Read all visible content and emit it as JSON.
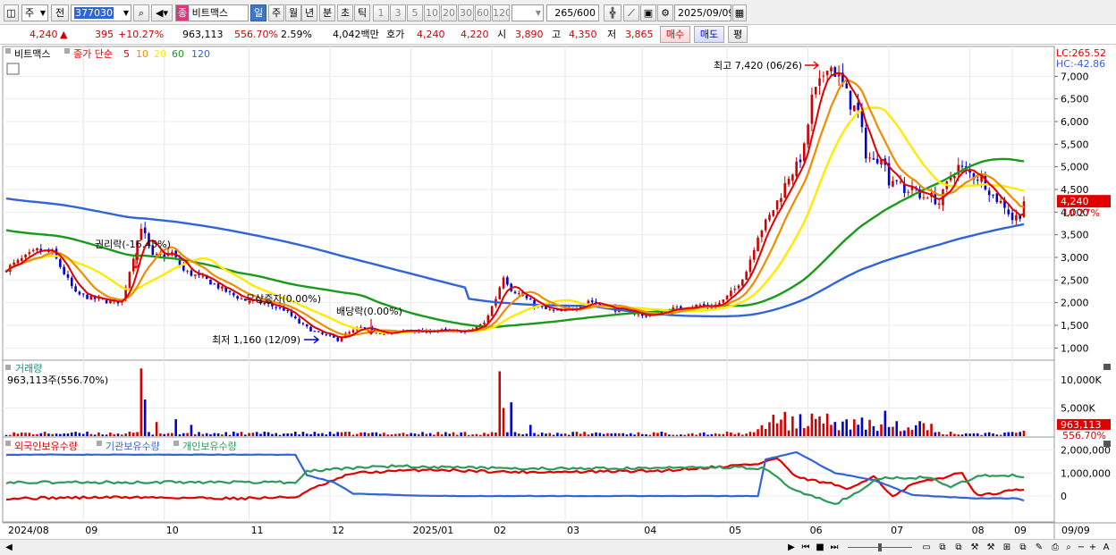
{
  "toolbar": {
    "market": "주",
    "prev": "전",
    "code": "377030",
    "name_badge": "종",
    "name": "비트맥스",
    "periods": [
      "일",
      "주",
      "월",
      "년",
      "분",
      "초",
      "틱"
    ],
    "active_period": "일",
    "intervals": [
      "1",
      "3",
      "5",
      "10",
      "20",
      "30",
      "60",
      "120"
    ],
    "count": "265",
    "count_max": "/600",
    "date": "2025/09/09"
  },
  "quote": {
    "price": "4,240",
    "arrow": "▲",
    "change": "395",
    "change_pct": "+10.27%",
    "volume": "963,113",
    "vol_ratio": "556.70%",
    "turnover": "2.59%",
    "amount": "4,042백만",
    "bid_label": "호가",
    "ask": "4,240",
    "bid": "4,220",
    "open_label": "시",
    "open": "3,890",
    "high_label": "고",
    "high": "4,350",
    "low_label": "저",
    "low": "3,865",
    "buy": "매수",
    "sell": "매도",
    "fav": "평"
  },
  "colors": {
    "up": "#d10000",
    "down": "#0000d0",
    "ma5": "#e00000",
    "ma10": "#f08c00",
    "ma20": "#ffeb00",
    "ma60": "#1a9a1a",
    "ma120": "#3064d8",
    "foreign": "#e00000",
    "inst": "#3064d8",
    "indiv": "#2e9a5a",
    "badge": "#e00000"
  },
  "price_panel": {
    "stock_label": "비트맥스",
    "ma_title": "종가 단순",
    "ma_labels": [
      "5",
      "10",
      "20",
      "60",
      "120"
    ],
    "lc": "LC:265.52",
    "hc": "HC:-42.86",
    "price_tag": "4,240",
    "pct_tag": "10.27%",
    "annotations": {
      "high": "최고 7,420 (06/26)",
      "low": "최저 1,160 (12/09)",
      "rights": "권리락(-16.45%)",
      "bonus": "무상증자(0.00%)",
      "dividend": "배당락(0.00%)"
    }
  },
  "volume_panel": {
    "title": "거래량",
    "value": "963,113주(556.70%)",
    "tag1": "963,113",
    "tag2": "556.70%"
  },
  "holdings_panel": {
    "labels": [
      "외국인보유수량",
      "기관보유수량",
      "개인보유수량"
    ]
  },
  "chart_data": {
    "type": "candlestick",
    "title": "비트맥스",
    "x_labels": [
      "2024/08",
      "09",
      "10",
      "11",
      "12",
      "2025/01",
      "02",
      "03",
      "04",
      "05",
      "06",
      "07",
      "08",
      "09",
      "09/09"
    ],
    "price_ticks": [
      "7,000",
      "6,500",
      "6,000",
      "5,500",
      "5,000",
      "4,500",
      "4,000",
      "3,500",
      "3,000",
      "2,500",
      "2,000",
      "1,500",
      "1,000"
    ],
    "price_range": [
      750,
      7500
    ],
    "volume_ticks": [
      "10,000K",
      "5,000K"
    ],
    "holdings_ticks": [
      "2,000,000",
      "1,000,000",
      "0"
    ],
    "close_keypoints": [
      [
        0,
        2750
      ],
      [
        8,
        3150
      ],
      [
        12,
        3100
      ],
      [
        18,
        2200
      ],
      [
        22,
        2100
      ],
      [
        28,
        2000
      ],
      [
        30,
        2050
      ],
      [
        35,
        3700
      ],
      [
        38,
        3000
      ],
      [
        43,
        3100
      ],
      [
        46,
        2700
      ],
      [
        52,
        2500
      ],
      [
        58,
        2200
      ],
      [
        62,
        2050
      ],
      [
        66,
        2000
      ],
      [
        72,
        1850
      ],
      [
        76,
        1550
      ],
      [
        80,
        1350
      ],
      [
        84,
        1250
      ],
      [
        86,
        1180
      ],
      [
        88,
        1300
      ],
      [
        92,
        1450
      ],
      [
        96,
        1350
      ],
      [
        100,
        1330
      ],
      [
        104,
        1400
      ],
      [
        108,
        1350
      ],
      [
        112,
        1400
      ],
      [
        116,
        1350
      ],
      [
        120,
        1380
      ],
      [
        124,
        1550
      ],
      [
        127,
        2100
      ],
      [
        129,
        2600
      ],
      [
        131,
        2300
      ],
      [
        134,
        2150
      ],
      [
        137,
        1950
      ],
      [
        140,
        1850
      ],
      [
        144,
        1800
      ],
      [
        148,
        1900
      ],
      [
        151,
        2050
      ],
      [
        154,
        1950
      ],
      [
        158,
        1850
      ],
      [
        162,
        1800
      ],
      [
        165,
        1700
      ],
      [
        168,
        1750
      ],
      [
        172,
        1850
      ],
      [
        176,
        1900
      ],
      [
        180,
        1950
      ],
      [
        183,
        1900
      ],
      [
        186,
        2050
      ],
      [
        189,
        2300
      ],
      [
        192,
        2700
      ],
      [
        195,
        3500
      ],
      [
        198,
        3900
      ],
      [
        201,
        4400
      ],
      [
        203,
        4800
      ],
      [
        205,
        5000
      ],
      [
        207,
        5400
      ],
      [
        209,
        6500
      ],
      [
        211,
        6800
      ],
      [
        213,
        7300
      ],
      [
        215,
        7100
      ],
      [
        217,
        6800
      ],
      [
        219,
        6400
      ],
      [
        221,
        6200
      ],
      [
        223,
        5300
      ],
      [
        225,
        5100
      ],
      [
        227,
        5300
      ],
      [
        229,
        4700
      ],
      [
        231,
        4750
      ],
      [
        233,
        4400
      ],
      [
        235,
        4600
      ],
      [
        237,
        4300
      ],
      [
        239,
        4400
      ],
      [
        242,
        4200
      ],
      [
        245,
        4800
      ],
      [
        247,
        5000
      ],
      [
        249,
        4900
      ],
      [
        251,
        4800
      ],
      [
        253,
        4750
      ],
      [
        256,
        4350
      ],
      [
        259,
        4150
      ],
      [
        261,
        3850
      ],
      [
        263,
        3950
      ],
      [
        264,
        4240
      ]
    ],
    "ma120_start": 4300,
    "ma60_start": 3600,
    "holdings_keypoints": {
      "foreign": [
        [
          0,
          -100
        ],
        [
          30,
          -50
        ],
        [
          60,
          -100
        ],
        [
          75,
          -50
        ],
        [
          80,
          350
        ],
        [
          90,
          1000
        ],
        [
          110,
          1150
        ],
        [
          130,
          1050
        ],
        [
          150,
          1050
        ],
        [
          170,
          1100
        ],
        [
          195,
          1400
        ],
        [
          200,
          1650
        ],
        [
          205,
          800
        ],
        [
          215,
          500
        ],
        [
          218,
          250
        ],
        [
          225,
          900
        ],
        [
          230,
          -50
        ],
        [
          235,
          500
        ],
        [
          240,
          700
        ],
        [
          248,
          1000
        ],
        [
          252,
          0
        ],
        [
          262,
          250
        ],
        [
          264,
          250
        ]
      ],
      "institution": [
        [
          0,
          1800
        ],
        [
          75,
          1800
        ],
        [
          78,
          900
        ],
        [
          85,
          600
        ],
        [
          90,
          100
        ],
        [
          110,
          0
        ],
        [
          140,
          0
        ],
        [
          195,
          0
        ],
        [
          197,
          1600
        ],
        [
          205,
          1900
        ],
        [
          215,
          1000
        ],
        [
          225,
          700
        ],
        [
          235,
          50
        ],
        [
          245,
          -50
        ],
        [
          252,
          -100
        ],
        [
          262,
          -100
        ],
        [
          264,
          -200
        ]
      ],
      "individual": [
        [
          0,
          600
        ],
        [
          75,
          600
        ],
        [
          78,
          1100
        ],
        [
          100,
          1300
        ],
        [
          130,
          1200
        ],
        [
          160,
          1200
        ],
        [
          190,
          1250
        ],
        [
          197,
          1200
        ],
        [
          200,
          800
        ],
        [
          205,
          200
        ],
        [
          215,
          -350
        ],
        [
          220,
          100
        ],
        [
          226,
          750
        ],
        [
          233,
          800
        ],
        [
          240,
          800
        ],
        [
          245,
          350
        ],
        [
          252,
          900
        ],
        [
          262,
          900
        ],
        [
          264,
          800
        ]
      ]
    }
  }
}
